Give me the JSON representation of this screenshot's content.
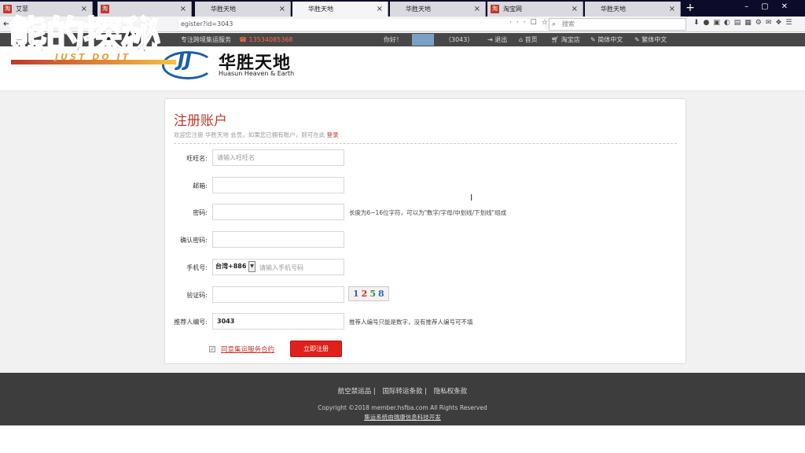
{
  "browser": {
    "tabs": [
      {
        "label": "艾菲",
        "favicon": "淘"
      },
      {
        "label": "",
        "favicon": "淘"
      },
      {
        "label": "华胜天地",
        "favicon": ""
      },
      {
        "label": "华胜天地",
        "favicon": "",
        "active": true
      },
      {
        "label": "华胜天地",
        "favicon": ""
      },
      {
        "label": "淘宝网",
        "favicon": "淘"
      },
      {
        "label": "华胜天地",
        "favicon": ""
      }
    ],
    "url": "egister?id=3043",
    "search_placeholder": "搜索"
  },
  "sitebar": {
    "service": "专注跨境集运服务",
    "phone": "13534085368",
    "greeting": "你好！",
    "user_id": "（3043）",
    "logout": "退出",
    "home": "首页",
    "taobao": "淘宝店",
    "simplified": "简体中文",
    "traditional": "繁体中文"
  },
  "logo": {
    "cn": "华胜天地",
    "en": "Huasun Heaven & Earth",
    "mark": "JJ"
  },
  "watermark": {
    "big": "熊的探秘",
    "small": "JUST DO IT"
  },
  "form": {
    "title": "注册账户",
    "subtitle_prefix": "欢迎您注册 华胜天地 会员，如果您已拥有账户，则可在此",
    "login_link": "登录",
    "fields": {
      "wangwang": {
        "label": "旺旺名:",
        "placeholder": "请输入旺旺名"
      },
      "email": {
        "label": "邮箱:"
      },
      "password": {
        "label": "密码:",
        "hint": "长度为6~16位字符，可以为\"数字/字母/中划线/下划线\"组成"
      },
      "confirm": {
        "label": "确认密码:"
      },
      "mobile": {
        "label": "手机号:",
        "country": "台湾+886",
        "placeholder": "请输入手机号码"
      },
      "captcha": {
        "label": "验证码:",
        "code": [
          "1",
          "2",
          "5",
          "8"
        ]
      },
      "referrer": {
        "label": "推荐人编号:",
        "value": "3043",
        "hint": "推荐人编号只能是数字，没有推荐人编号可不填"
      }
    },
    "agree_text": "同意集运服务合约",
    "submit_label": "立即注册"
  },
  "footer": {
    "links": [
      "航空禁运品 |",
      "国际转运条款 |",
      "隐私权条款"
    ],
    "copyright": "Copyright ©2018 member.hsfba.com All Rights Reserved",
    "developer": "集运系统由瑞康信息科技开发"
  },
  "colors": {
    "accent": "#c0392b",
    "submit": "#e0201a",
    "footer_bg": "#3d3d3d",
    "topbar_bg": "#474747"
  }
}
